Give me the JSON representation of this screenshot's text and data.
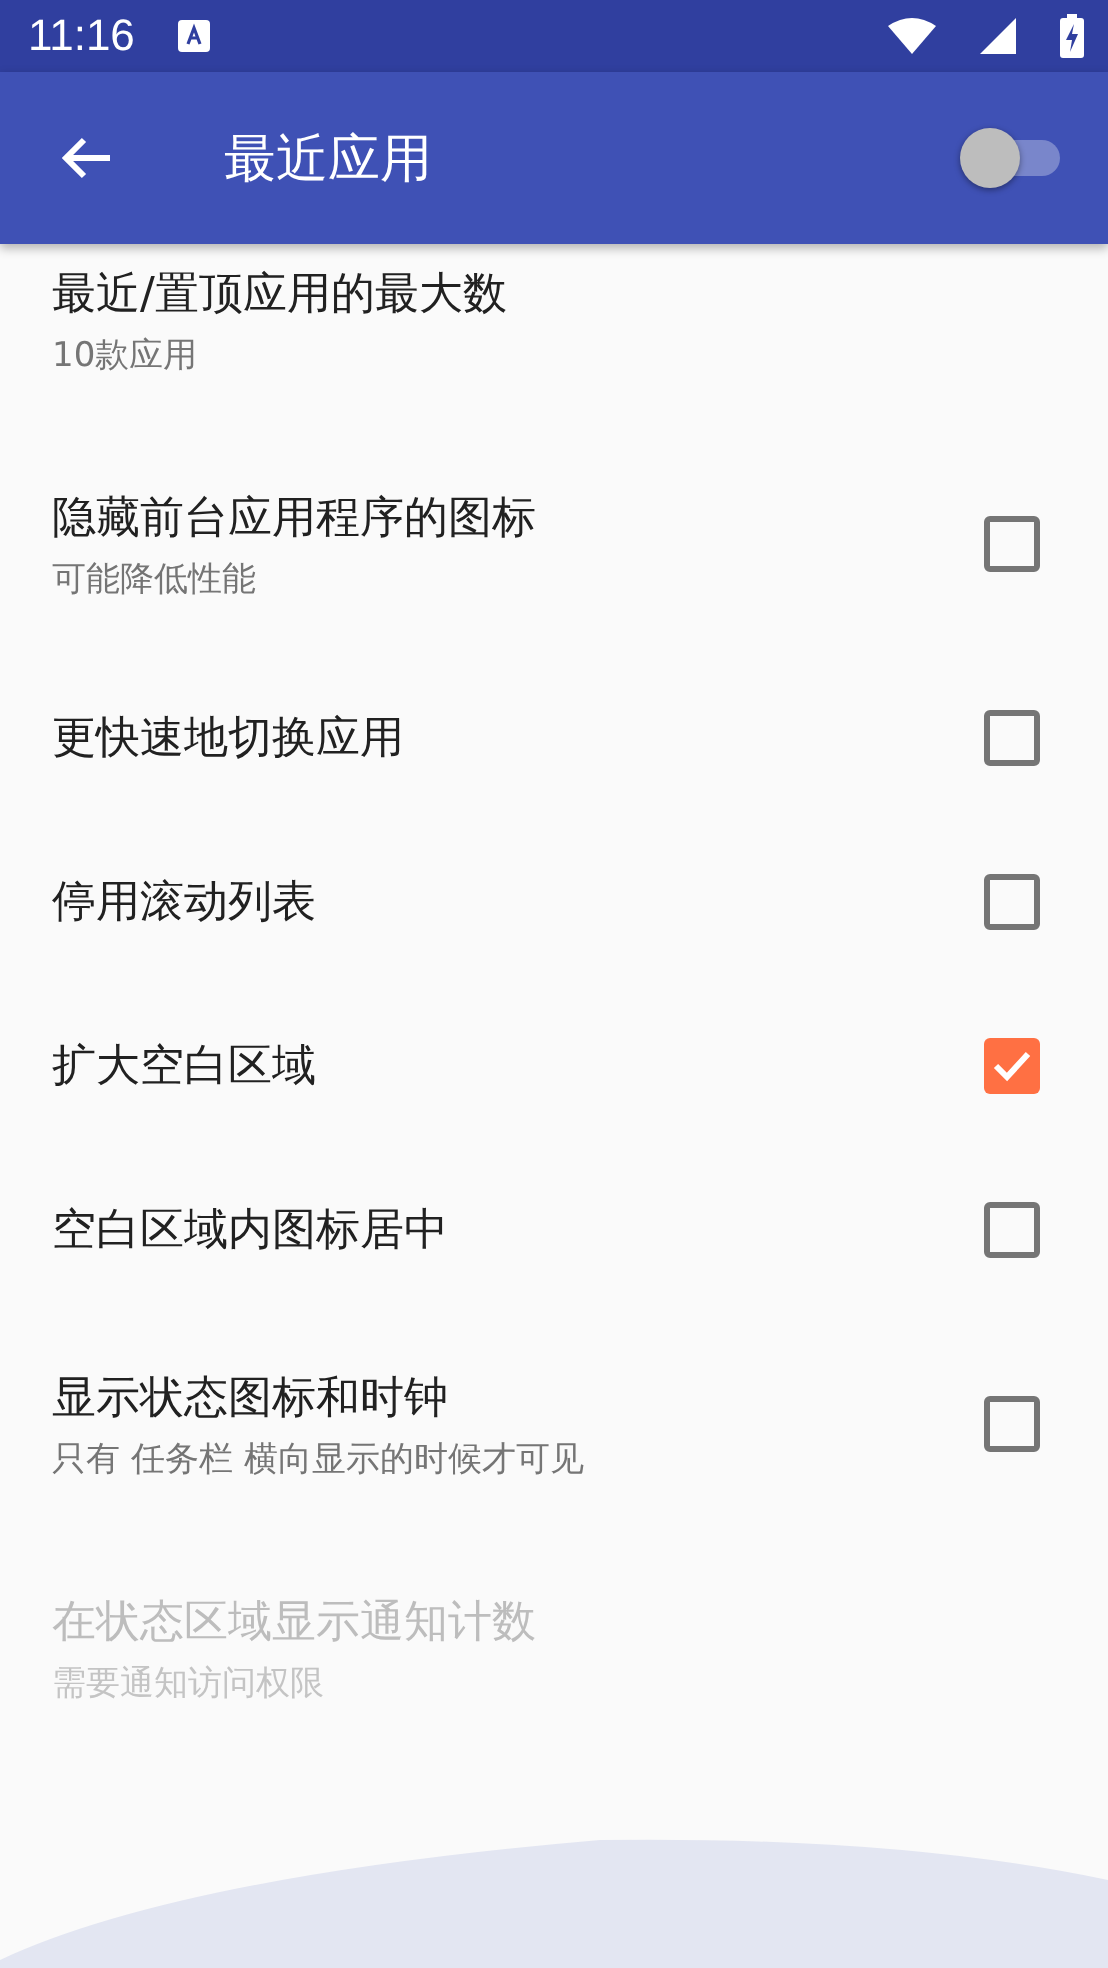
{
  "status_bar": {
    "time": "11:16"
  },
  "app_bar": {
    "title": "最近应用",
    "switch_on": false
  },
  "items": [
    {
      "kind": "info",
      "title": "最近/置顶应用的最大数",
      "summary": "10款应用",
      "disabled": false
    },
    {
      "kind": "checkbox",
      "title": "隐藏前台应用程序的图标",
      "summary": "可能降低性能",
      "checked": false,
      "disabled": false
    },
    {
      "kind": "checkbox",
      "title": "更快速地切换应用",
      "checked": false,
      "disabled": false
    },
    {
      "kind": "checkbox",
      "title": "停用滚动列表",
      "checked": false,
      "disabled": false
    },
    {
      "kind": "checkbox",
      "title": "扩大空白区域",
      "checked": true,
      "disabled": false
    },
    {
      "kind": "checkbox",
      "title": "空白区域内图标居中",
      "checked": false,
      "disabled": false
    },
    {
      "kind": "checkbox",
      "title": "显示状态图标和时钟",
      "summary": "只有 任务栏 横向显示的时候才可见",
      "checked": false,
      "disabled": false
    },
    {
      "kind": "info",
      "title": "在状态区域显示通知计数",
      "summary": "需要通知访问权限",
      "disabled": true
    }
  ]
}
